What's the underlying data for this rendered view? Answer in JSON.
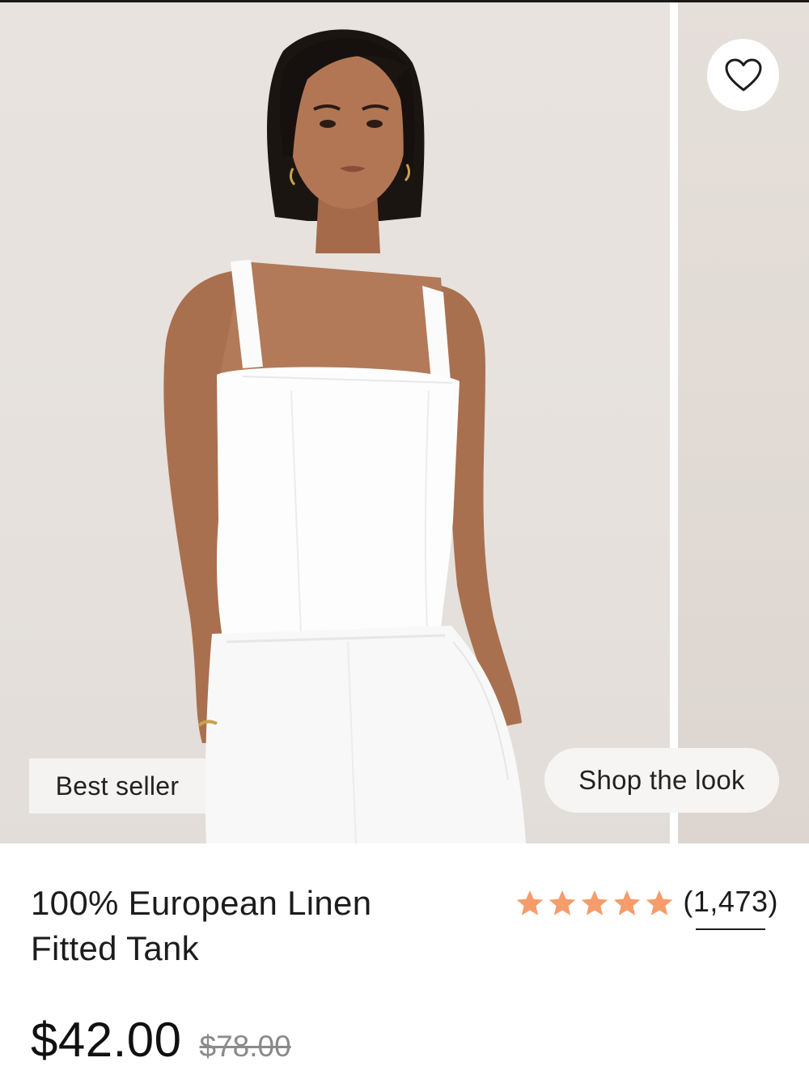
{
  "gallery": {
    "badge_label": "Best seller",
    "shop_the_look_label": "Shop the look",
    "wishlist_icon": "heart-outline-icon"
  },
  "product": {
    "title_line1": "100% European Linen",
    "title_line2": "Fitted Tank",
    "rating": {
      "stars": 5,
      "star_color": "#f59c6a",
      "review_count": "(1,473)"
    },
    "price": {
      "sale": "$42.00",
      "original": "$78.00"
    }
  }
}
